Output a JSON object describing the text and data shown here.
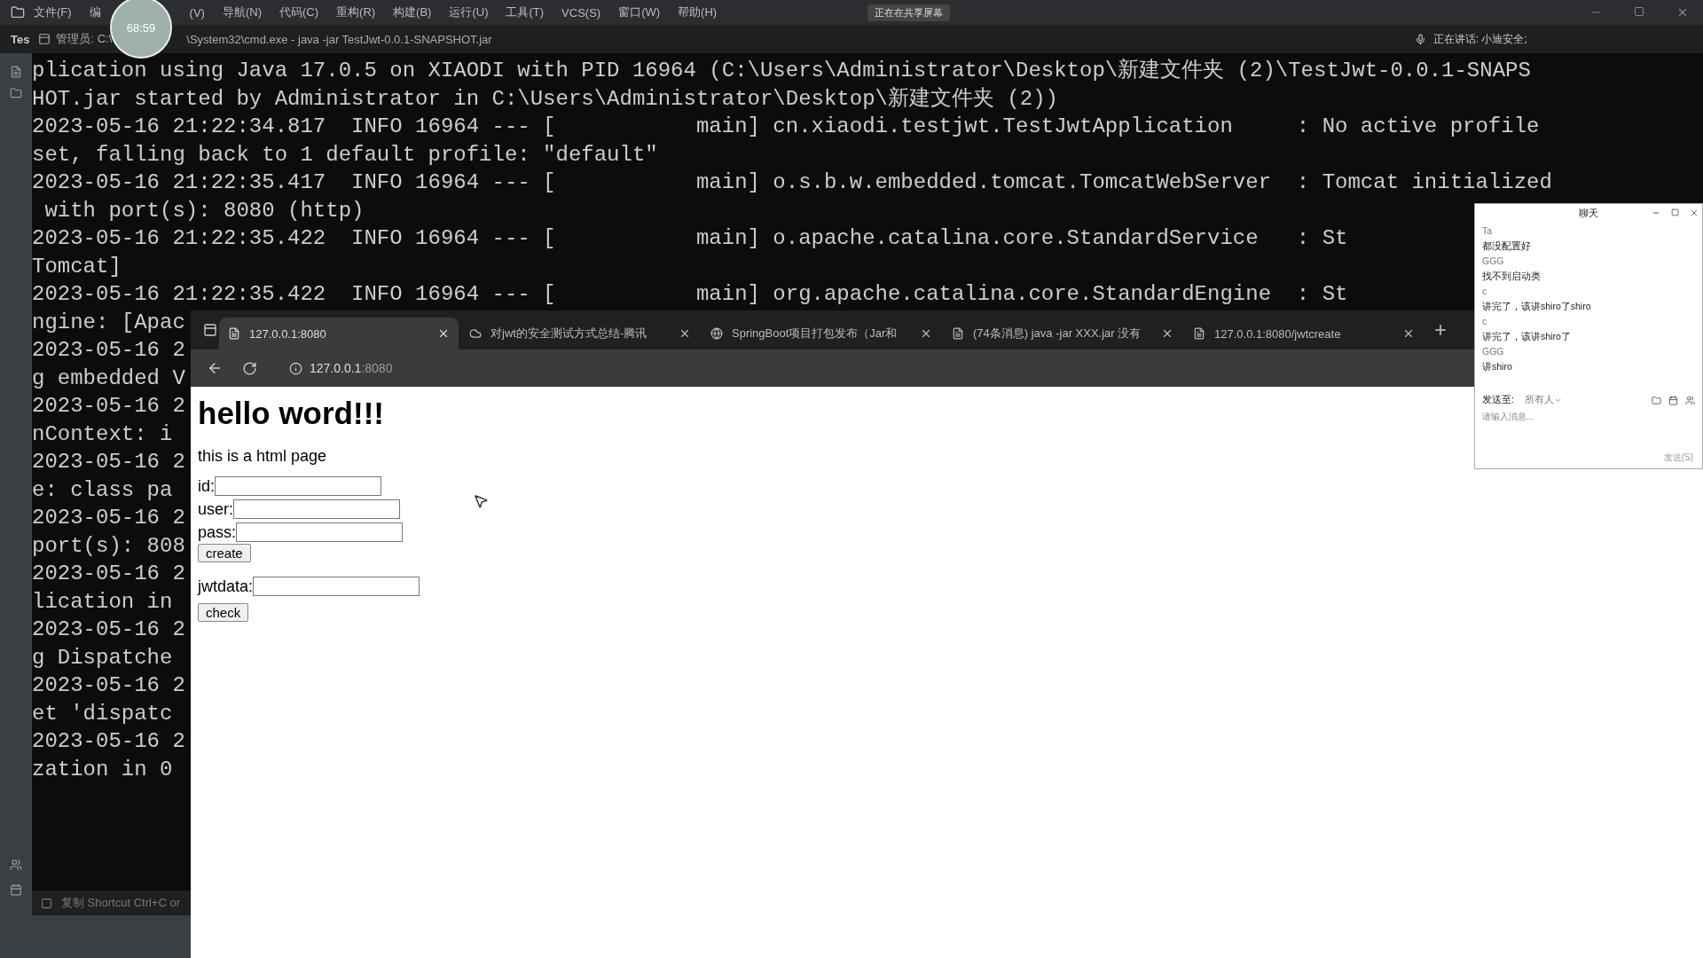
{
  "ide": {
    "menu": [
      "文件(F)",
      "编",
      "(V)",
      "导航(N)",
      "代码(C)",
      "重构(R)",
      "构建(B)",
      "运行(U)",
      "工具(T)",
      "VCS(S)",
      "窗口(W)",
      "帮助(H)"
    ],
    "sharing_badge": "正在在共享屏幕",
    "timer": "68:59",
    "project_label": "Tes",
    "speaking": "正在讲话: 小迪安全;"
  },
  "console": {
    "title_left": "管理员: C:\\",
    "title_right": "\\System32\\cmd.exe - java -jar TestJwt-0.0.1-SNAPSHOT.jar",
    "lines": [
      "plication using Java 17.0.5 on XIAODI with PID 16964 (C:\\Users\\Administrator\\Desktop\\新建文件夹 (2)\\TestJwt-0.0.1-SNAPS",
      "HOT.jar started by Administrator in C:\\Users\\Administrator\\Desktop\\新建文件夹 (2))",
      "2023-05-16 21:22:34.817  INFO 16964 --- [           main] cn.xiaodi.testjwt.TestJwtApplication     : No active profile",
      "set, falling back to 1 default profile: \"default\"",
      "2023-05-16 21:22:35.417  INFO 16964 --- [           main] o.s.b.w.embedded.tomcat.TomcatWebServer  : Tomcat initialized",
      " with port(s): 8080 (http)",
      "2023-05-16 21:22:35.422  INFO 16964 --- [           main] o.apache.catalina.core.StandardService   : St",
      "Tomcat]",
      "2023-05-16 21:22:35.422  INFO 16964 --- [           main] org.apache.catalina.core.StandardEngine  : St",
      "ngine: [Apac",
      "2023-05-16 2",
      "g embedded V",
      "2023-05-16 2",
      "nContext: i",
      "2023-05-16 2",
      "e: class pa",
      "2023-05-16 2",
      "port(s): 808",
      "2023-05-16 2",
      "lication in",
      "2023-05-16 2",
      "g Dispatche",
      "2023-05-16 2",
      "et 'dispatc",
      "2023-05-16 2",
      "zation in 0"
    ],
    "status": "复制 Shortcut Ctrl+C or"
  },
  "browser": {
    "tabs": [
      {
        "title": "127.0.0.1:8080",
        "selected": true
      },
      {
        "title": "对jwt的安全测试方式总结-腾讯",
        "selected": false
      },
      {
        "title": "SpringBoot项目打包发布（Jar和",
        "selected": false
      },
      {
        "title": "(74条消息) java -jar XXX.jar 没有",
        "selected": false
      },
      {
        "title": "127.0.0.1:8080/jwtcreate",
        "selected": false
      }
    ],
    "address": {
      "host": "127.0.0.1",
      "port": ":8080"
    },
    "page": {
      "heading": "hello word!!!",
      "subtitle": "this is a html page",
      "fields": [
        {
          "label": "id:"
        },
        {
          "label": "user:"
        },
        {
          "label": "pass:"
        }
      ],
      "create_button": "create",
      "jwt_label": "jwtdata:",
      "check_button": "check"
    }
  },
  "chat": {
    "title": "聊天",
    "messages": [
      {
        "kind": "sender",
        "text": "Ta"
      },
      {
        "kind": "message",
        "text": "都没配置好"
      },
      {
        "kind": "sender",
        "text": "GGG"
      },
      {
        "kind": "message",
        "text": "找不到启动类"
      },
      {
        "kind": "sender",
        "text": "c"
      },
      {
        "kind": "message",
        "text": "讲完了，该讲shiro了shiro"
      },
      {
        "kind": "sender",
        "text": "c"
      },
      {
        "kind": "message",
        "text": "讲完了，该讲shiro了"
      },
      {
        "kind": "sender",
        "text": "GGG"
      },
      {
        "kind": "message",
        "text": "讲shiro"
      }
    ],
    "send_to_label": "发送至:",
    "recipient": "所有人",
    "input_placeholder": "请输入消息...",
    "send_button": "发送(S)"
  }
}
